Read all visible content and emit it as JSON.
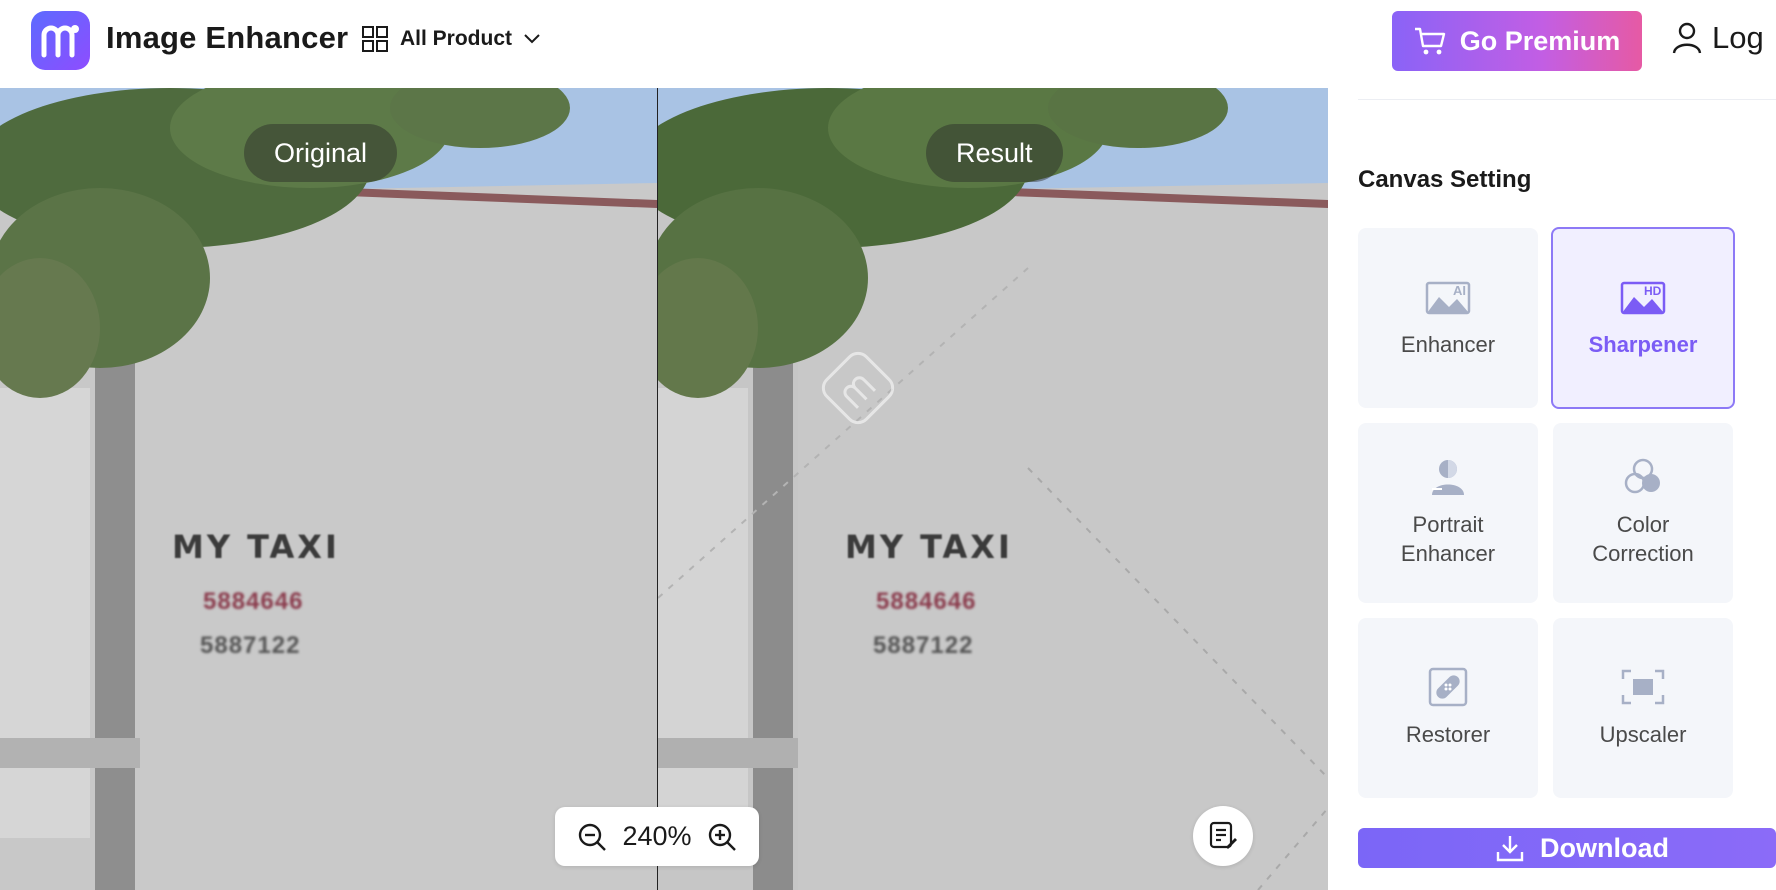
{
  "header": {
    "app_title": "Image Enhancer",
    "all_product_label": "All Product",
    "premium_label": "Go Premium",
    "login_label": "Log"
  },
  "canvas": {
    "original_label": "Original",
    "result_label": "Result",
    "photo_text": {
      "sign": "MY TAXI",
      "phone_1": "5884646",
      "phone_2": "5887122"
    },
    "zoom_value": "240%"
  },
  "sidebar": {
    "section_title": "Canvas Setting",
    "tools": [
      {
        "label": "Enhancer",
        "icon": "ai-image-icon",
        "active": false
      },
      {
        "label": "Sharpener",
        "icon": "hd-image-icon",
        "active": true
      },
      {
        "label": "Portrait\nEnhancer",
        "icon": "portrait-icon",
        "active": false
      },
      {
        "label": "Color\nCorrection",
        "icon": "color-circles-icon",
        "active": false
      },
      {
        "label": "Restorer",
        "icon": "bandage-icon",
        "active": false
      },
      {
        "label": "Upscaler",
        "icon": "expand-icon",
        "active": false
      }
    ],
    "download_label": "Download"
  },
  "colors": {
    "accent": "#7b5cf5",
    "premium_gradient_start": "#8a63f7",
    "premium_gradient_end": "#e65aa4"
  }
}
